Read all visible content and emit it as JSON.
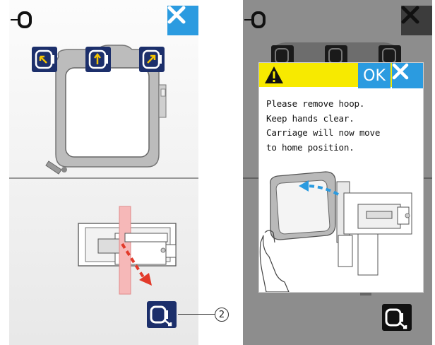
{
  "left_screen": {
    "frame_buttons": [
      {
        "name": "move-frame-top-left",
        "icon": "arrow-up-left-icon"
      },
      {
        "name": "move-frame-center",
        "icon": "arrow-up-icon"
      },
      {
        "name": "move-frame-top-right",
        "icon": "arrow-up-right-icon"
      }
    ],
    "home_button_icon": "hoop-return-icon",
    "close_icon": "close-icon"
  },
  "right_screen": {
    "dialog": {
      "warning_icon": "warning-icon",
      "ok_label": "OK",
      "message_lines": [
        "Please remove hoop.",
        "Keep hands clear.",
        "Carriage will now move",
        "to home position."
      ]
    }
  },
  "callout": {
    "number": "2"
  },
  "colors": {
    "accent_blue": "#2b9be0",
    "icon_navy": "#1c2f6b",
    "warning_yellow": "#f7ea00",
    "arrow_red": "#e23a2a",
    "arrow_blue": "#2b9be0"
  }
}
